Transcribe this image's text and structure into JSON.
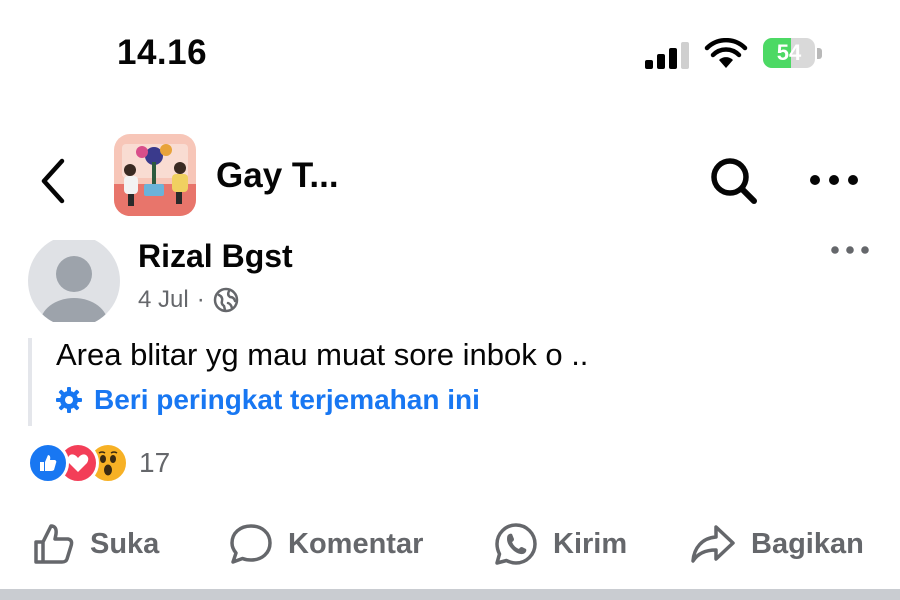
{
  "status_bar": {
    "time": "14.16",
    "battery_level": "54",
    "battery_fraction": 0.54,
    "icons": [
      "cellular-signal-icon",
      "wifi-icon",
      "battery-charging-icon"
    ]
  },
  "header": {
    "group_title": "Gay T...",
    "icons": [
      "back-chevron-icon",
      "group-thumbnail",
      "search-icon",
      "more-options-icon"
    ]
  },
  "post": {
    "author": "Rizal Bgst",
    "date": "4 Jul",
    "separator": "·",
    "privacy_icon": "globe-icon",
    "text": "Area blitar yg mau muat sore inbok o ..",
    "translation_prompt": "Beri peringkat terjemahan ini",
    "reaction_count": "17",
    "reactions": [
      "like-icon",
      "love-icon",
      "wow-icon"
    ]
  },
  "actions": [
    {
      "label": "Suka",
      "icon": "thumbs-up-icon"
    },
    {
      "label": "Komentar",
      "icon": "comment-bubble-icon"
    },
    {
      "label": "Kirim",
      "icon": "whatsapp-icon"
    },
    {
      "label": "Bagikan",
      "icon": "share-arrow-icon"
    }
  ],
  "colors": {
    "accent": "#1877f2",
    "battery_green": "#4cd964",
    "secondary_text": "#65676b"
  }
}
